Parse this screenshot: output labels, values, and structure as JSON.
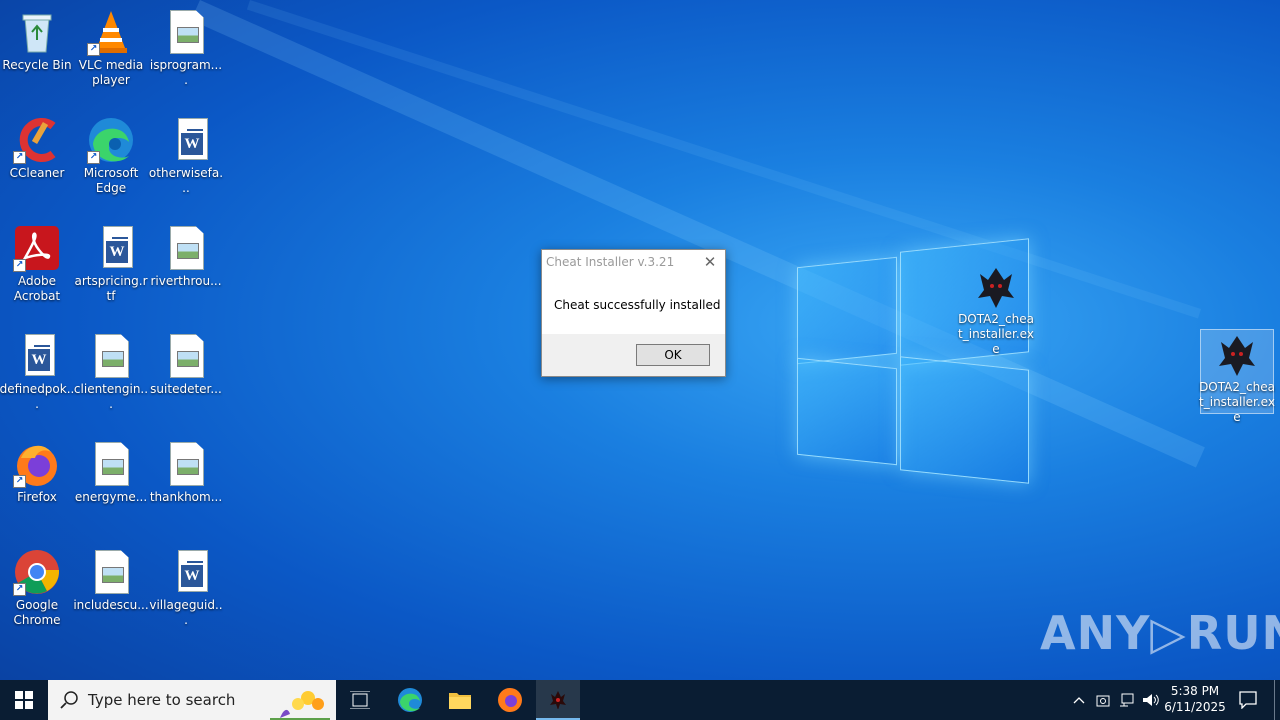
{
  "desktop": {
    "icons": [
      {
        "label": "Recycle Bin",
        "icon": "recycle-bin-icon"
      },
      {
        "label": "VLC media player",
        "icon": "vlc-icon"
      },
      {
        "label": "isprogram....",
        "icon": "image-file-icon"
      },
      {
        "label": "CCleaner",
        "icon": "ccleaner-icon"
      },
      {
        "label": "Microsoft Edge",
        "icon": "edge-icon"
      },
      {
        "label": "otherwisefa...",
        "icon": "word-doc-icon"
      },
      {
        "label": "Adobe Acrobat",
        "icon": "acrobat-icon"
      },
      {
        "label": "artspricing.rtf",
        "icon": "word-doc-icon"
      },
      {
        "label": "riverthrou...",
        "icon": "image-file-icon"
      },
      {
        "label": "definedpok...",
        "icon": "word-doc-icon"
      },
      {
        "label": "clientengin...",
        "icon": "image-file-icon"
      },
      {
        "label": "suitedeter...",
        "icon": "image-file-icon"
      },
      {
        "label": "Firefox",
        "icon": "firefox-icon"
      },
      {
        "label": "energyme...",
        "icon": "image-file-icon"
      },
      {
        "label": "thankhom...",
        "icon": "image-file-icon"
      },
      {
        "label": "Google Chrome",
        "icon": "chrome-icon"
      },
      {
        "label": "includescu...",
        "icon": "image-file-icon"
      },
      {
        "label": "villageguid...",
        "icon": "word-doc-icon"
      }
    ],
    "exe_icons": [
      {
        "label": "DOTA2_cheat_installer.exe",
        "icon": "dota-exe-icon"
      },
      {
        "label": "DOTA2_cheat_installer.exe",
        "icon": "dota-exe-icon"
      }
    ]
  },
  "dialog": {
    "title": "Cheat Installer v.3.21",
    "message": "Cheat successfully installed",
    "ok_label": "OK",
    "close_glyph": "✕"
  },
  "taskbar": {
    "search_placeholder": "Type here to search",
    "time": "5:38 PM",
    "date": "6/11/2025"
  },
  "watermark": "ANY▷RUN",
  "colors": {
    "taskbar_bg": "#0a1d33",
    "desktop_bg": "#0b58c6"
  }
}
